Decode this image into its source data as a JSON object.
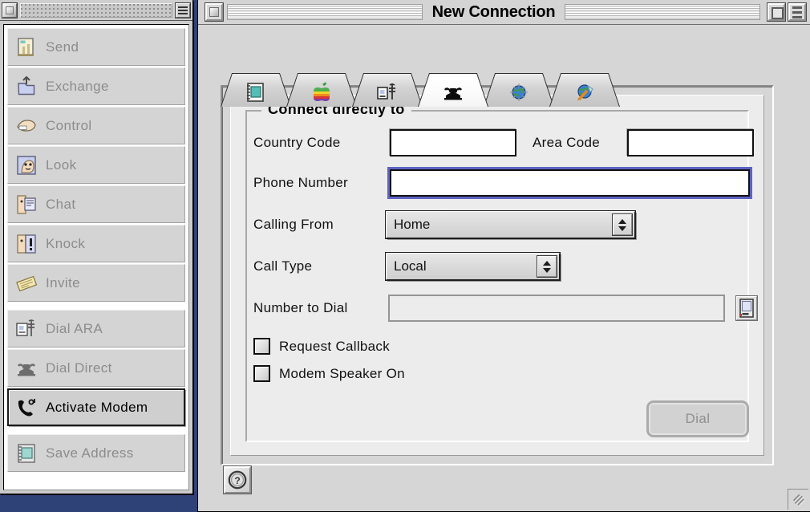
{
  "desktop": {
    "background": "#2e4277"
  },
  "palette": {
    "title": "",
    "close_label": "close",
    "menu_label": "palette options",
    "groups": [
      {
        "items": [
          {
            "label": "Send",
            "icon": "send-document-icon",
            "enabled": false,
            "selected": false
          },
          {
            "label": "Exchange",
            "icon": "exchange-folder-icon",
            "enabled": false,
            "selected": false
          },
          {
            "label": "Control",
            "icon": "control-hand-icon",
            "enabled": false,
            "selected": false
          },
          {
            "label": "Look",
            "icon": "look-face-icon",
            "enabled": false,
            "selected": false
          },
          {
            "label": "Chat",
            "icon": "chat-person-icon",
            "enabled": false,
            "selected": false
          },
          {
            "label": "Knock",
            "icon": "knock-alert-icon",
            "enabled": false,
            "selected": false
          },
          {
            "label": "Invite",
            "icon": "invite-ticket-icon",
            "enabled": false,
            "selected": false
          }
        ]
      },
      {
        "items": [
          {
            "label": "Dial ARA",
            "icon": "dial-ara-icon",
            "enabled": false,
            "selected": false
          },
          {
            "label": "Dial Direct",
            "icon": "telephone-icon",
            "enabled": false,
            "selected": false
          },
          {
            "label": "Activate Modem",
            "icon": "modem-handset-icon",
            "enabled": true,
            "selected": true
          }
        ]
      },
      {
        "items": [
          {
            "label": "Save Address",
            "icon": "address-book-icon",
            "enabled": false,
            "selected": false
          }
        ]
      }
    ]
  },
  "window": {
    "title": "New Connection",
    "close_label": "close",
    "zoom_label": "zoom",
    "collapse_label": "collapse",
    "grow_label": "resize",
    "help_label": "?"
  },
  "tabs": [
    {
      "name": "address-book-tab",
      "icon": "address-book-icon",
      "selected": false
    },
    {
      "name": "apple-tab",
      "icon": "apple-logo-icon",
      "selected": false
    },
    {
      "name": "ara-tab",
      "icon": "dial-ara-icon",
      "selected": false
    },
    {
      "name": "phone-tab",
      "icon": "telephone-icon",
      "selected": true
    },
    {
      "name": "internet-tab",
      "icon": "globe-icon",
      "selected": false
    },
    {
      "name": "tools-tab",
      "icon": "globe-tools-icon",
      "selected": false
    }
  ],
  "form": {
    "legend": "Connect directly to",
    "country_code": {
      "label": "Country Code",
      "value": "",
      "placeholder": ""
    },
    "area_code": {
      "label": "Area Code",
      "value": "",
      "placeholder": ""
    },
    "phone_number": {
      "label": "Phone Number",
      "value": "",
      "placeholder": "",
      "focused": true,
      "focus_color": "#5c62c4"
    },
    "calling_from": {
      "label": "Calling From",
      "value": "Home",
      "options": [
        "Home"
      ]
    },
    "call_type": {
      "label": "Call Type",
      "value": "Local",
      "options": [
        "Local"
      ]
    },
    "number_to_dial": {
      "label": "Number to Dial",
      "value": "",
      "readonly": true
    },
    "number_to_dial_button": "dial-preview-icon",
    "request_callback": {
      "label": "Request Callback",
      "checked": false
    },
    "modem_speaker": {
      "label": "Modem Speaker On",
      "checked": false
    },
    "dial_button": {
      "label": "Dial",
      "enabled": false
    }
  }
}
